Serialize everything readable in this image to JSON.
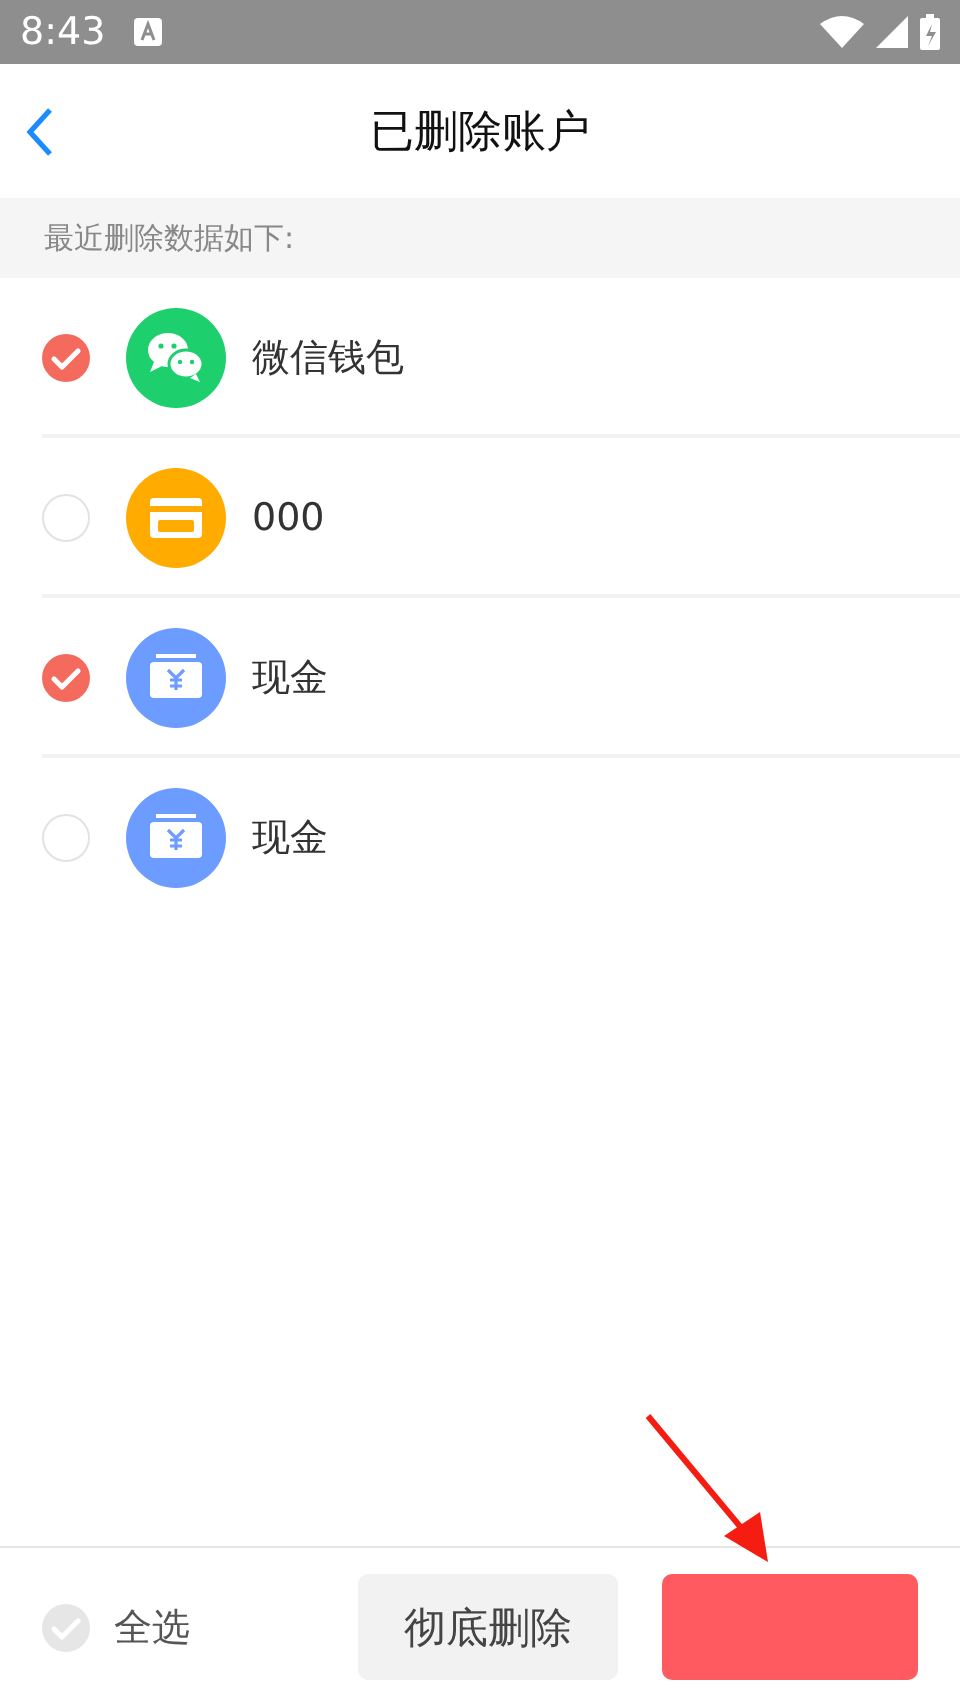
{
  "status_bar": {
    "time": "8:43"
  },
  "header": {
    "title": "已删除账户"
  },
  "subheading": "最近删除数据如下:",
  "accounts": [
    {
      "name": "微信钱包",
      "kind": "wechat",
      "checked": true
    },
    {
      "name": "000",
      "kind": "vip",
      "checked": false
    },
    {
      "name": "现金",
      "kind": "cash",
      "checked": true
    },
    {
      "name": "现金",
      "kind": "cash",
      "checked": false
    }
  ],
  "footer": {
    "select_all": {
      "label": "全选",
      "checked": false
    },
    "delete_button": "彻底删除"
  }
}
